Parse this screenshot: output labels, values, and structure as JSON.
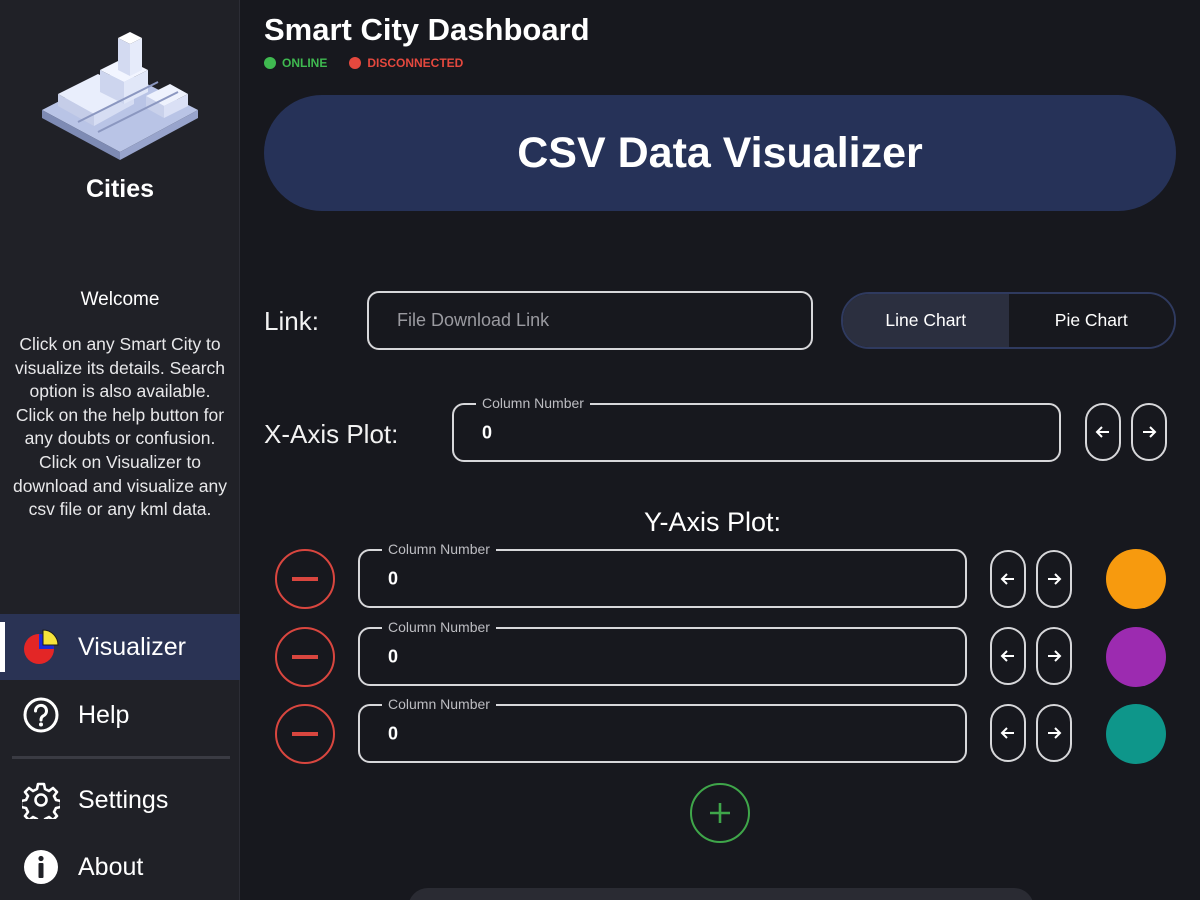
{
  "app": {
    "title": "Smart City Dashboard",
    "status_online": "ONLINE",
    "status_disconnected": "DISCONNECTED",
    "colors": {
      "online": "#3fb950",
      "disconnected": "#e5483e",
      "banner": "#263258"
    }
  },
  "sidebar": {
    "title": "Cities",
    "welcome_title": "Welcome",
    "welcome_text": "Click on any Smart City to visualize its details. Search option is also available. Click on the help button for any doubts or confusion. Click on Visualizer to download and visualize any csv file or any kml data.",
    "items": [
      {
        "label": "Visualizer",
        "icon": "pie-chart-icon",
        "active": true
      },
      {
        "label": "Help",
        "icon": "help-circle-icon",
        "active": false
      },
      {
        "label": "Settings",
        "icon": "gear-icon",
        "active": false
      },
      {
        "label": "About",
        "icon": "info-icon",
        "active": false
      }
    ]
  },
  "main": {
    "banner_title": "CSV Data Visualizer",
    "link_label": "Link:",
    "link_placeholder": "File Download Link",
    "chart_toggle": {
      "options": [
        "Line Chart",
        "Pie Chart"
      ],
      "selected": "Line Chart"
    },
    "x_axis": {
      "label": "X-Axis Plot:",
      "field_label": "Column Number",
      "value": "0"
    },
    "y_axis": {
      "label": "Y-Axis Plot:",
      "rows": [
        {
          "field_label": "Column Number",
          "value": "0",
          "color": "#f79a0e"
        },
        {
          "field_label": "Column Number",
          "value": "0",
          "color": "#9c2bb0"
        },
        {
          "field_label": "Column Number",
          "value": "0",
          "color": "#0e968a"
        }
      ]
    }
  }
}
